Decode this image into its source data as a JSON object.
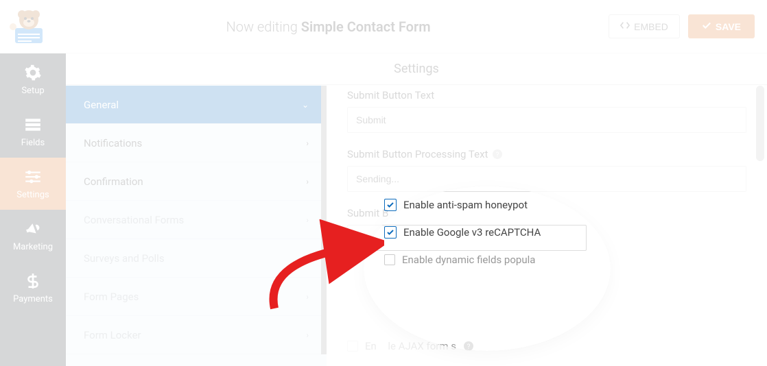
{
  "topbar": {
    "editing_prefix": "Now editing ",
    "form_name": "Simple Contact Form",
    "embed_label": "EMBED",
    "save_label": "SAVE"
  },
  "sidebar": {
    "items": [
      {
        "label": "Setup",
        "icon": "gear"
      },
      {
        "label": "Fields",
        "icon": "list"
      },
      {
        "label": "Settings",
        "icon": "sliders",
        "active": true
      },
      {
        "label": "Marketing",
        "icon": "bullhorn"
      },
      {
        "label": "Payments",
        "icon": "dollar"
      }
    ]
  },
  "settings_header": "Settings",
  "accordion": {
    "items": [
      {
        "label": "General",
        "active": true,
        "expanded": true
      },
      {
        "label": "Notifications"
      },
      {
        "label": "Confirmation"
      },
      {
        "label": "Conversational Forms",
        "disabled": true
      },
      {
        "label": "Surveys and Polls",
        "disabled": true
      },
      {
        "label": "Form Pages",
        "disabled": true
      },
      {
        "label": "Form Locker",
        "disabled": true
      }
    ]
  },
  "content": {
    "submit_btn_label": "Submit Button Text",
    "submit_btn_value": "Submit",
    "processing_label": "Submit Button Processing Text",
    "processing_value": "Sending...",
    "submit_partial": "Submit B",
    "checkboxes": {
      "honeypot": "Enable anti-spam honeypot",
      "recaptcha": "Enable Google v3 reCAPTCHA",
      "dynamic": "Enable dynamic fields popula",
      "ajax_pre": "En",
      "ajax_mid": "le AJAX form s"
    }
  }
}
